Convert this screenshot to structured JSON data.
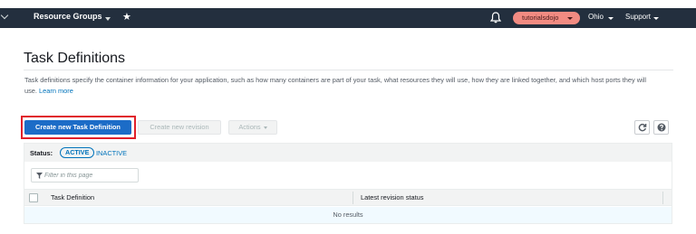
{
  "topnav": {
    "resource_groups": "Resource Groups",
    "user": "tutorialsdojo",
    "region": "Ohio",
    "support": "Support"
  },
  "page": {
    "title": "Task Definitions",
    "description": "Task definitions specify the container information for your application, such as how many containers are part of your task, what resources they will use, how they are linked together, and which host ports they will use.",
    "learn_more": "Learn more"
  },
  "toolbar": {
    "create_task_definition": "Create new Task Definition",
    "create_revision": "Create new revision",
    "actions": "Actions"
  },
  "table": {
    "status_label": "Status:",
    "status_active": "ACTIVE",
    "status_inactive": "INACTIVE",
    "filter_placeholder": "Filter in this page",
    "columns": [
      "Task Definition",
      "Latest revision status"
    ],
    "empty_message": "No results"
  },
  "colors": {
    "nav_bg": "#232f3e",
    "primary_button": "#1c6cc7",
    "highlight_border": "#e0202a",
    "link": "#0073bb",
    "user_pill": "#f28b82"
  },
  "icons": [
    "chevron-right-icon",
    "caret-down-icon",
    "pin-icon",
    "bell-icon",
    "refresh-icon",
    "help-icon",
    "filter-icon"
  ]
}
